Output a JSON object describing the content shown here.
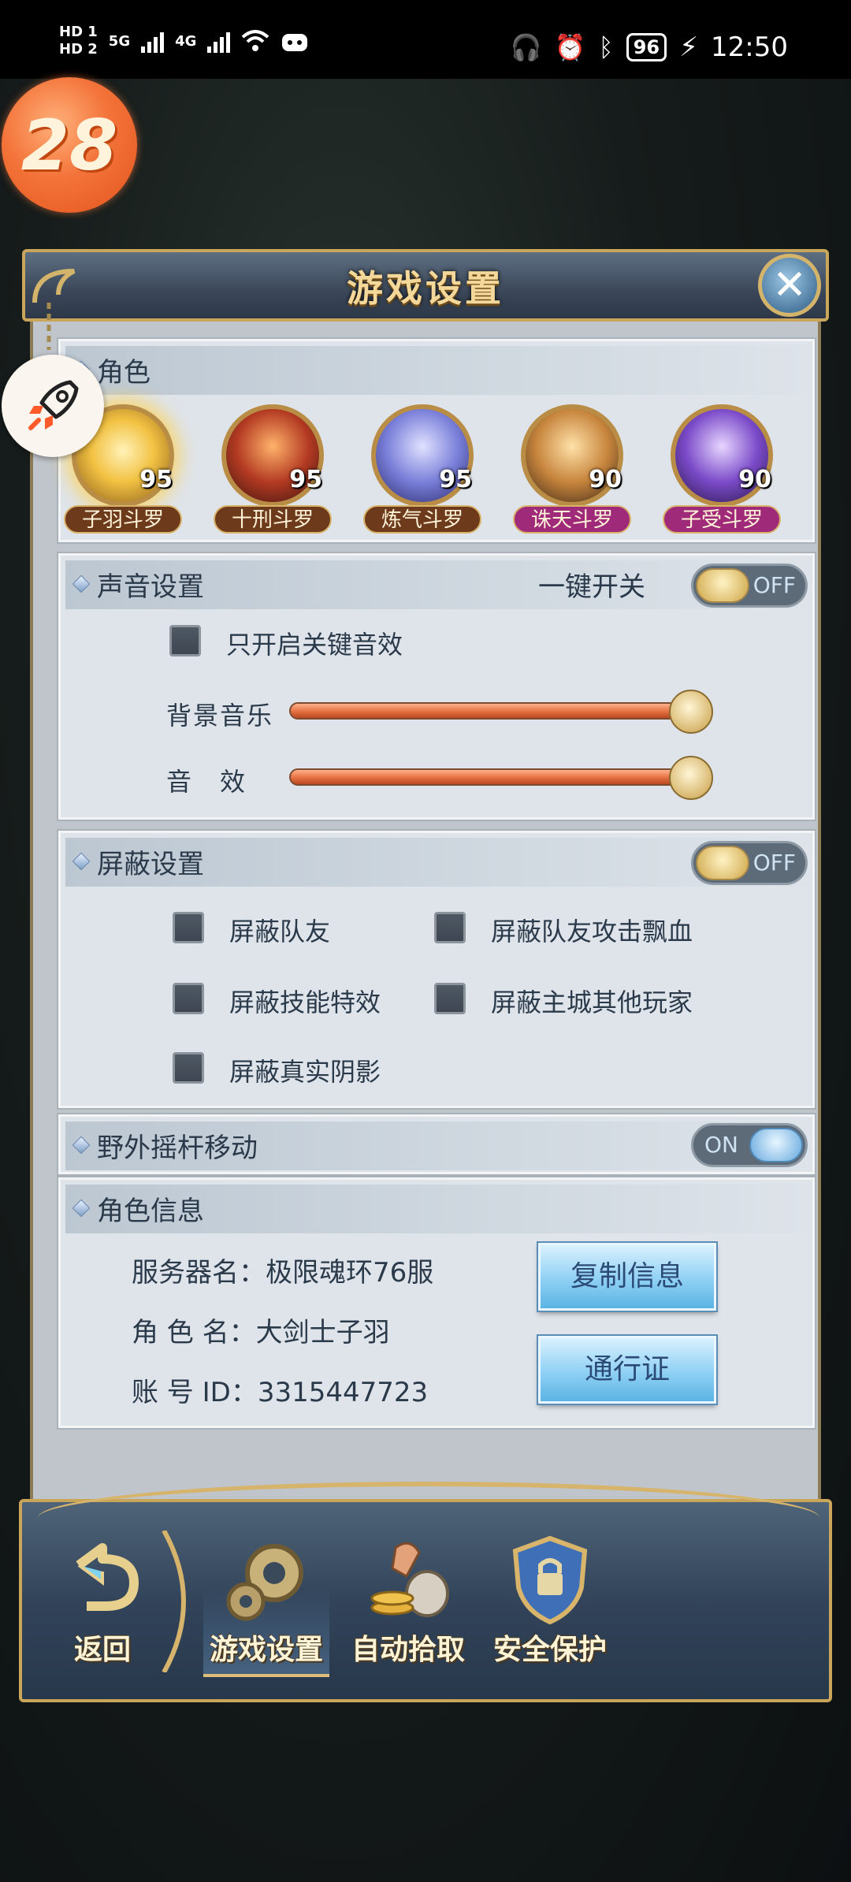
{
  "status_bar": {
    "left": [
      "HD 1",
      "HD 2",
      "5G",
      "4G"
    ],
    "battery": "96",
    "time": "12:50"
  },
  "floating": {
    "level_badge": "28"
  },
  "dialog": {
    "title": "游戏设置",
    "close_icon": "close-icon"
  },
  "roles": {
    "title": "角色",
    "items": [
      {
        "name": "子羽斗罗",
        "level": "95",
        "color": "#f2c243",
        "label_bg": "#6d3a1c"
      },
      {
        "name": "十刑斗罗",
        "level": "95",
        "color": "#b33a22",
        "label_bg": "#6d3a1c"
      },
      {
        "name": "炼气斗罗",
        "level": "95",
        "color": "#7a7fd9",
        "label_bg": "#6d3a1c"
      },
      {
        "name": "诛天斗罗",
        "level": "90",
        "color": "#c7853d",
        "label_bg": "#a02a7a"
      },
      {
        "name": "子受斗罗",
        "level": "90",
        "color": "#7b4bc9",
        "label_bg": "#a02a7a"
      }
    ]
  },
  "sound": {
    "title": "声音设置",
    "master_label": "一键开关",
    "master_state": "OFF",
    "key_only_label": "只开启关键音效",
    "bgm_label": "背景音乐",
    "sfx_label": "音　效",
    "bgm_level": 0.95,
    "sfx_level": 0.95
  },
  "shield": {
    "title": "屏蔽设置",
    "state": "OFF",
    "options": {
      "teammates": "屏蔽队友",
      "teammate_damage": "屏蔽队友攻击飘血",
      "skill_effects": "屏蔽技能特效",
      "city_players": "屏蔽主城其他玩家",
      "shadows": "屏蔽真实阴影"
    }
  },
  "joystick": {
    "title": "野外摇杆移动",
    "state": "ON"
  },
  "role_info": {
    "title": "角色信息",
    "server": "服务器名：极限魂环76服",
    "role_name": "角 色 名：大剑士子羽",
    "account": "账 号 ID：3315447723",
    "copy_btn": "复制信息",
    "pass_btn": "通行证"
  },
  "bottom_nav": {
    "back": "返回",
    "game_settings": "游戏设置",
    "auto_pickup": "自动拾取",
    "security": "安全保护"
  }
}
